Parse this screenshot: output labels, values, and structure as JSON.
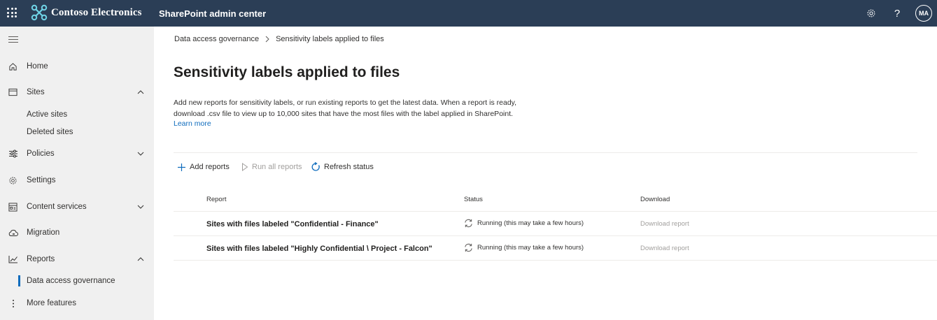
{
  "header": {
    "org_name": "Contoso Electronics",
    "app_name": "SharePoint admin center",
    "avatar_initials": "MA",
    "bar_color": "#2b3e56",
    "icons": [
      "waffle-icon",
      "contoso-logo",
      "settings-icon",
      "help-icon"
    ]
  },
  "sidebar": {
    "items": [
      {
        "label": "Home",
        "icon": "home-icon"
      },
      {
        "label": "Sites",
        "icon": "sites-icon",
        "expanded": true
      },
      {
        "label": "Active sites"
      },
      {
        "label": "Deleted sites"
      },
      {
        "label": "Policies",
        "icon": "policies-icon",
        "expanded": false
      },
      {
        "label": "Settings",
        "icon": "settings-icon"
      },
      {
        "label": "Content services",
        "icon": "content-services-icon",
        "expanded": false
      },
      {
        "label": "Migration",
        "icon": "migration-icon"
      },
      {
        "label": "Reports",
        "icon": "reports-icon",
        "expanded": true
      },
      {
        "label": "Data access governance",
        "selected": true
      },
      {
        "label": "More features",
        "icon": "more-icon"
      }
    ],
    "accent": "#0f6cbd"
  },
  "breadcrumb": {
    "parent": "Data access governance",
    "current": "Sensitivity labels applied to files"
  },
  "page": {
    "title": "Sensitivity labels applied to files",
    "description_line1": "Add new reports for sensitivity labels, or run existing reports to get the latest data. When a report is ready,",
    "description_line2": "download .csv file to view up to 10,000 sites that have the most files with the label applied in SharePoint.",
    "learn_more": "Learn more"
  },
  "commands": {
    "add_reports": "Add reports",
    "run_all_reports": "Run all reports",
    "refresh_status": "Refresh status"
  },
  "table": {
    "columns": {
      "report": "Report",
      "status": "Status",
      "download": "Download"
    },
    "rows": [
      {
        "report": "Sites with files labeled \"Confidential - Finance\"",
        "status": "Running (this may take a few hours)",
        "download": "Download report"
      },
      {
        "report": "Sites with files labeled \"Highly Confidential \\ Project - Falcon\"",
        "status": "Running (this may take a few hours)",
        "download": "Download report"
      }
    ]
  }
}
